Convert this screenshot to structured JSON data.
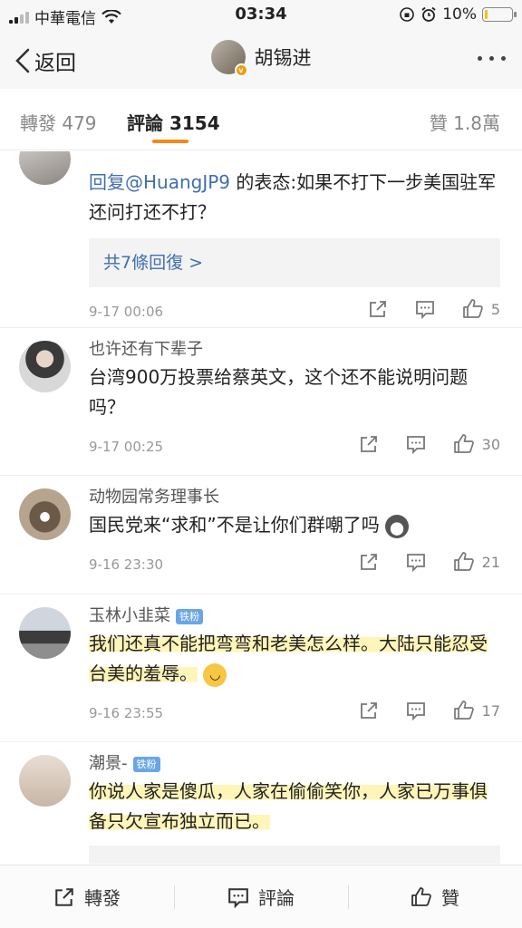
{
  "status_bar": {
    "carrier": "中華電信",
    "time": "03:34",
    "battery": "10%",
    "battery_level": 0.1
  },
  "nav": {
    "back_label": "返回",
    "title": "胡锡进"
  },
  "tabs": {
    "repost": "轉發 479",
    "comment": "評論 3154",
    "like": "贊 1.8萬"
  },
  "comments": [
    {
      "name": "",
      "text_mention": "回复@HuangJP9",
      "text": "的表态:如果不打下一步美国驻军还问打还不打？",
      "replies": "共7條回復 >",
      "time": "9-17 00:06",
      "likes": "5"
    },
    {
      "name": "也许还有下辈子",
      "text": "台湾900万投票给蔡英文，这个还不能说明问题吗？",
      "time": "9-17 00:25",
      "likes": "30"
    },
    {
      "name": "动物园常务理事长",
      "text": "国民党来“求和”不是让你们群嘲了吗",
      "time": "9-16 23:30",
      "likes": "21"
    },
    {
      "name": "玉林小韭菜",
      "badge": "铁粉",
      "text": "我们还真不能把弯弯和老美怎么样。大陆只能忍受台美的羞辱。",
      "time": "9-16 23:55",
      "likes": "17"
    },
    {
      "name": "潮景-",
      "badge": "铁粉",
      "text": "你说人家是傻瓜，人家在偷偷笑你，人家已万事俱备只欠宣布独立而已。"
    }
  ],
  "bottom_bar": {
    "repost": "轉發",
    "comment": "評論",
    "like": "贊"
  },
  "colors": {
    "accent": "#f28a1c",
    "link": "#3f6fb0",
    "highlight": "#fff5b8"
  }
}
